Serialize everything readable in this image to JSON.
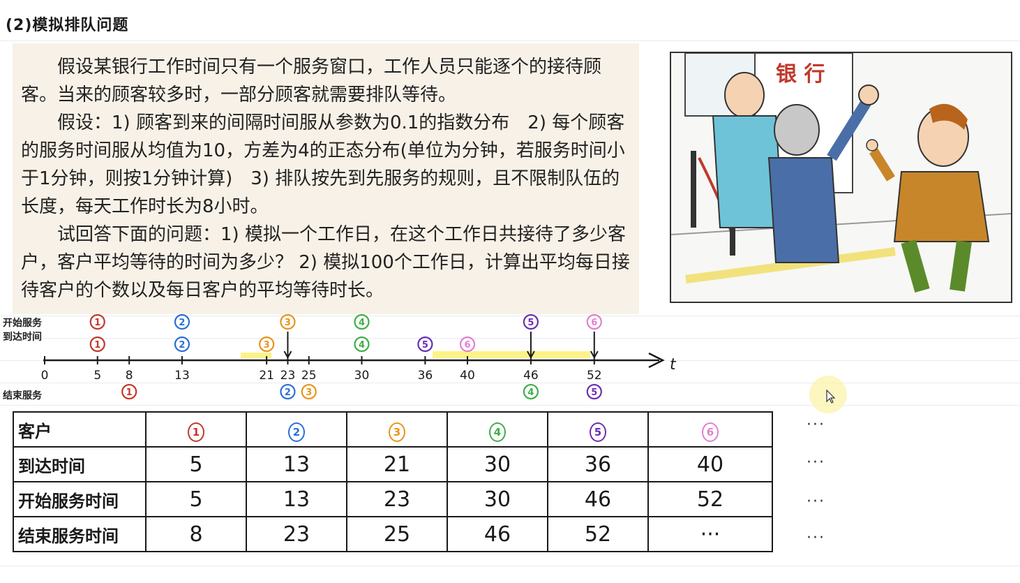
{
  "title": "(2)模拟排队问题",
  "problem": {
    "p1": "假设某银行工作时间只有一个服务窗口，工作人员只能逐个的接待顾客。当来的顾客较多时，一部分顾客就需要排队等待。",
    "p2": "假设：1) 顾客到来的间隔时间服从参数为0.1的指数分布　2) 每个顾客的服务时间服从均值为10，方差为4的正态分布(单位为分钟，若服务时间小于1分钟，则按1分钟计算)　3) 排队按先到先服务的规则，且不限制队伍的长度，每天工作时长为8小时。",
    "p3": "试回答下面的问题：1) 模拟一个工作日，在这个工作日共接待了多少客户，客户平均等待的时间为多少？ 2) 模拟100个工作日，计算出平均每日接待客户的个数以及每日客户的平均等待时长。"
  },
  "cartoon": {
    "sign": "银 行"
  },
  "timeline": {
    "label_start": "开始服务",
    "label_arrive": "到达时间",
    "label_end": "结束服务",
    "axis_var": "t",
    "ticks": [
      "0",
      "5",
      "8",
      "13",
      "21",
      "23",
      "25",
      "30",
      "36",
      "40",
      "46",
      "52"
    ],
    "colors": [
      "#c0392b",
      "#2c6fd6",
      "#e8941a",
      "#3fae49",
      "#6a2fb0",
      "#e27fd0"
    ]
  },
  "table": {
    "headers": [
      "客户",
      "到达时间",
      "开始服务时间",
      "结束服务时间"
    ],
    "customers": [
      "1",
      "2",
      "3",
      "4",
      "5",
      "6"
    ],
    "arrive": [
      "5",
      "13",
      "21",
      "30",
      "36",
      "40"
    ],
    "start": [
      "5",
      "13",
      "23",
      "30",
      "46",
      "52"
    ],
    "end": [
      "8",
      "23",
      "25",
      "46",
      "52",
      "···"
    ],
    "ellipsis": "···"
  }
}
